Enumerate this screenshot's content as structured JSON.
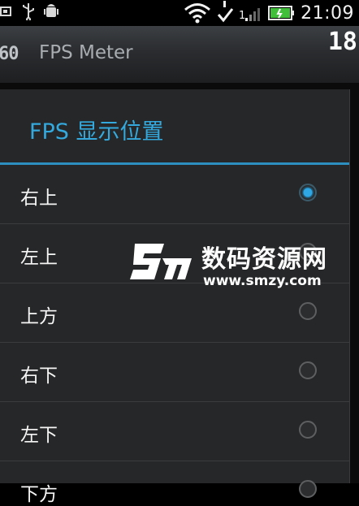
{
  "status_bar": {
    "time": "21:09",
    "left_icons": [
      "sd-card-icon",
      "usb-icon",
      "android-debug-icon"
    ],
    "right_icons": [
      "wifi-icon",
      "sync-check-icon",
      "signal-icon",
      "battery-charging-icon"
    ]
  },
  "app": {
    "logo": "60",
    "title": "FPS Meter",
    "counter": "18"
  },
  "dialog": {
    "title": "FPS 显示位置",
    "options": [
      {
        "label": "右上",
        "selected": true
      },
      {
        "label": "左上",
        "selected": false
      },
      {
        "label": "上方",
        "selected": false
      },
      {
        "label": "右下",
        "selected": false
      },
      {
        "label": "左下",
        "selected": false
      },
      {
        "label": "下方",
        "selected": false
      }
    ]
  },
  "watermark": {
    "cn": "数码资源网",
    "url": "www.smzy.com"
  },
  "colors": {
    "accent": "#34a9dd",
    "dialog_bg": "#262728",
    "divider": "#2d8fc0"
  }
}
